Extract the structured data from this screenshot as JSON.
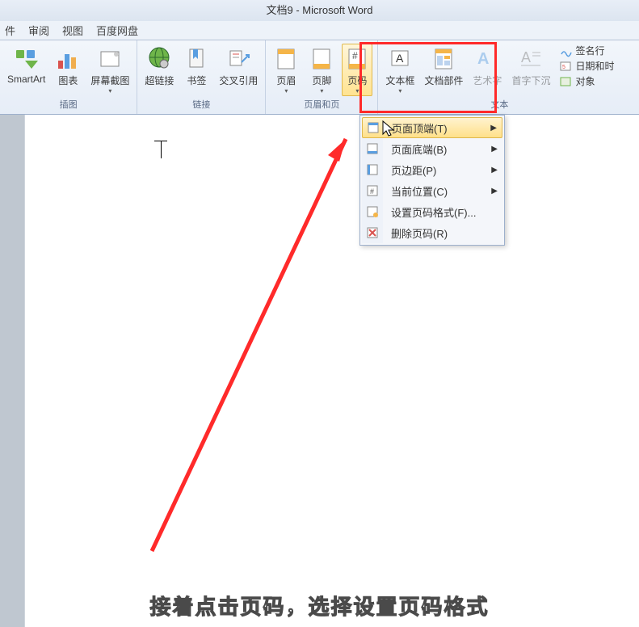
{
  "title": "文档9 - Microsoft Word",
  "menu": {
    "item1": "件",
    "item2": "审阅",
    "item3": "视图",
    "item4": "百度网盘"
  },
  "ribbon": {
    "smartart": "SmartArt",
    "chart": "图表",
    "screenshot": "屏幕截图",
    "hyperlink": "超链接",
    "bookmark": "书签",
    "crossref": "交叉引用",
    "header": "页眉",
    "footer": "页脚",
    "pagenumber": "页码",
    "textbox": "文本框",
    "quickparts": "文档部件",
    "wordart": "艺术字",
    "dropcap": "首字下沉",
    "signature": "签名行",
    "datetime": "日期和时",
    "object": "对象",
    "group_illustrations": "插图",
    "group_links": "链接",
    "group_headerfooter": "页眉和页",
    "group_text": "文本"
  },
  "dropdown": {
    "top": "页面顶端(T)",
    "bottom": "页面底端(B)",
    "margins": "页边距(P)",
    "current": "当前位置(C)",
    "format": "设置页码格式(F)...",
    "remove": "删除页码(R)"
  },
  "caption": "接着点击页码，选择设置页码格式"
}
